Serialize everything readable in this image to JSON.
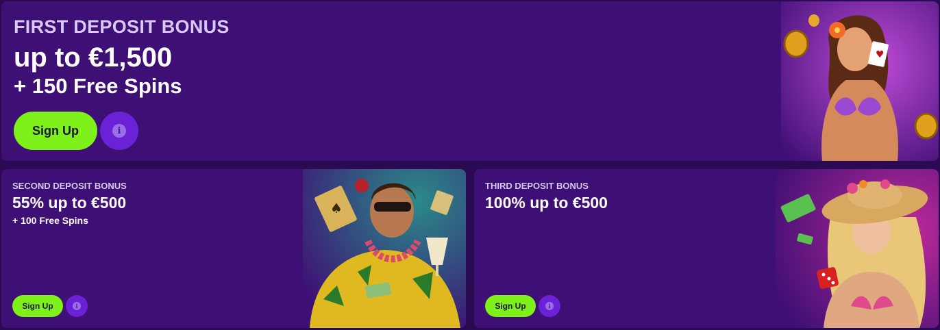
{
  "cards": {
    "first": {
      "title": "FIRST DEPOSIT BONUS",
      "amount": "up to €1,500",
      "spins": "+ 150 Free Spins",
      "signup_label": "Sign Up",
      "info_label": "i"
    },
    "second": {
      "title": "SECOND DEPOSIT BONUS",
      "amount": "55% up to €500",
      "spins": "+ 100 Free Spins",
      "signup_label": "Sign Up",
      "info_label": "i"
    },
    "third": {
      "title": "THIRD DEPOSIT BONUS",
      "amount": "100% up to €500",
      "signup_label": "Sign Up",
      "info_label": "i"
    }
  },
  "colors": {
    "page_background": "#2a0a52",
    "card_background": "#3e0f74",
    "signup_button": "#7ef01a",
    "info_button": "#6b21d6",
    "title_text": "#d9c8f5"
  },
  "icons": {
    "info": "info-icon",
    "character_main": "woman-with-cards-and-coins-illustration",
    "character_second": "man-in-hawaiian-shirt-illustration",
    "character_third": "woman-in-sun-hat-illustration"
  }
}
